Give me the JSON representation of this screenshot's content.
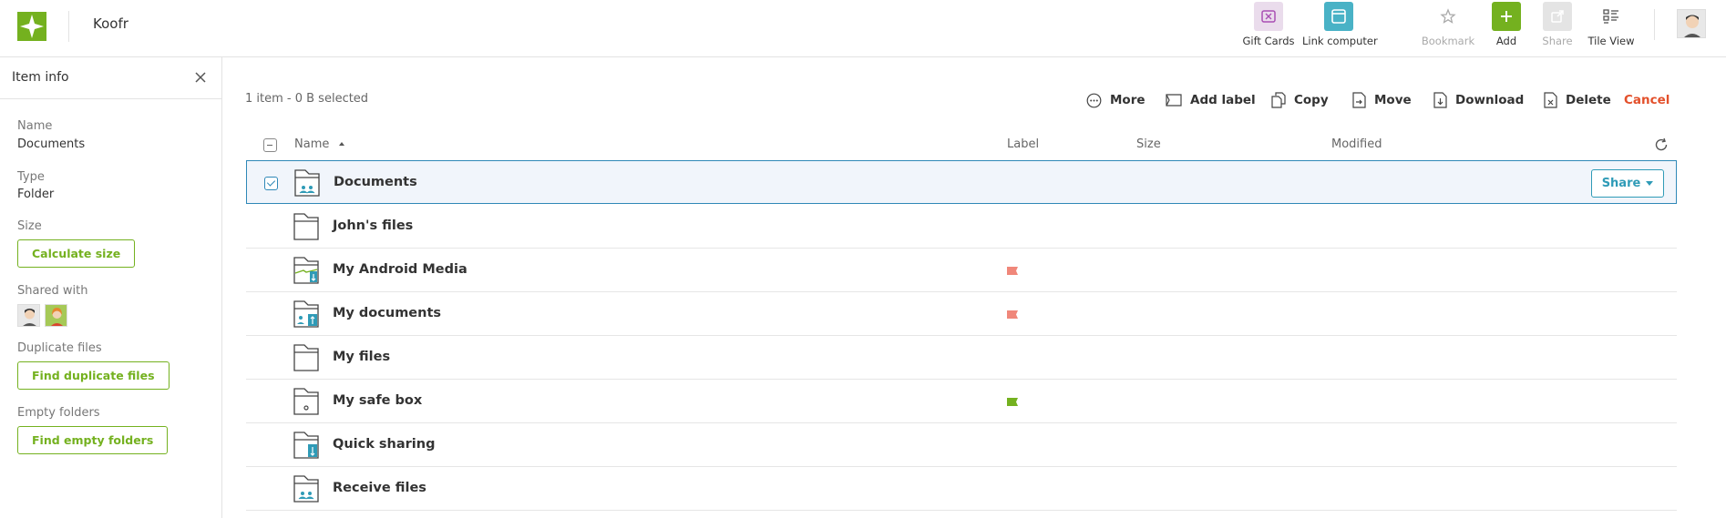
{
  "app": {
    "title": "Koofr",
    "brand_color": "#74b11f"
  },
  "toolbar": {
    "items": [
      {
        "label": "Gift Cards",
        "icon": "gift-card-icon",
        "color": "#a94fb4",
        "bg": "#eadcec",
        "enabled": true
      },
      {
        "label": "Link computer",
        "icon": "computer-icon",
        "color": "#ffffff",
        "bg": "#49b2c6",
        "enabled": true
      },
      {
        "label": "Bookmark",
        "icon": "star-icon",
        "enabled": false
      },
      {
        "label": "Add",
        "icon": "plus-icon",
        "color": "#ffffff",
        "bg": "#74b11f",
        "enabled": true
      },
      {
        "label": "Share",
        "icon": "share-icon",
        "enabled": false
      },
      {
        "label": "Tile View",
        "icon": "tile-view-icon",
        "enabled": true
      }
    ]
  },
  "sidebar": {
    "title": "Item info",
    "name_label": "Name",
    "name_value": "Documents",
    "type_label": "Type",
    "type_value": "Folder",
    "size_label": "Size",
    "calc_size_button": "Calculate size",
    "shared_with_label": "Shared with",
    "duplicate_label": "Duplicate files",
    "find_duplicates_button": "Find duplicate files",
    "empty_label": "Empty folders",
    "find_empty_button": "Find empty folders"
  },
  "selection": {
    "info": "1 item - 0 B selected",
    "actions": {
      "more": "More",
      "add_label": "Add label",
      "copy": "Copy",
      "move": "Move",
      "download": "Download",
      "delete": "Delete",
      "cancel": "Cancel"
    }
  },
  "table": {
    "columns": {
      "name": "Name",
      "label": "Label",
      "size": "Size",
      "modified": "Modified"
    },
    "share_button": "Share",
    "rows": [
      {
        "name": "Documents",
        "icon": "shared-folder-icon",
        "label_color": null,
        "selected": true
      },
      {
        "name": "John's files",
        "icon": "folder-icon",
        "label_color": null,
        "selected": false
      },
      {
        "name": "My Android Media",
        "icon": "android-folder-icon",
        "label_color": "#f0877a",
        "selected": false
      },
      {
        "name": "My documents",
        "icon": "upload-folder-icon",
        "label_color": "#f0877a",
        "selected": false
      },
      {
        "name": "My files",
        "icon": "folder-icon",
        "label_color": null,
        "selected": false
      },
      {
        "name": "My safe box",
        "icon": "safe-box-folder-icon",
        "label_color": "#74b11f",
        "selected": false
      },
      {
        "name": "Quick sharing",
        "icon": "quick-share-folder-icon",
        "label_color": null,
        "selected": false
      },
      {
        "name": "Receive files",
        "icon": "receive-folder-icon",
        "label_color": null,
        "selected": false
      }
    ]
  }
}
